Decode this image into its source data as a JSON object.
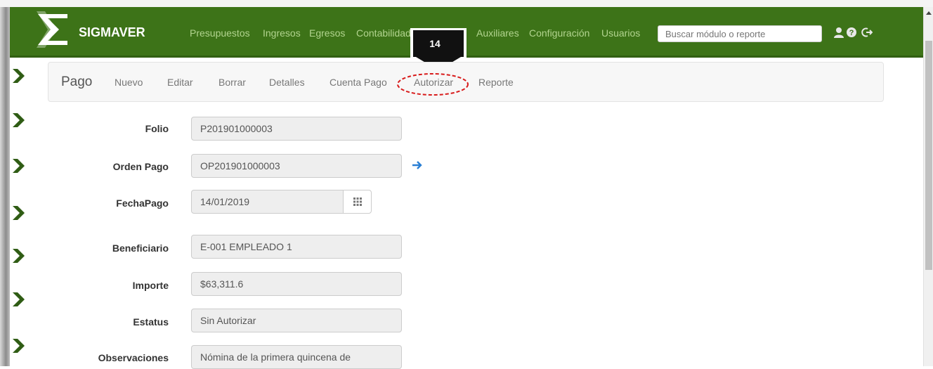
{
  "app": {
    "brand": "SIGMAVER",
    "accent_color": "#3d7318",
    "menu_color": "#b2d48f"
  },
  "navbar": {
    "menu": [
      "Presupuestos",
      "Ingresos",
      "Egresos",
      "Contabilidad",
      "Auxiliares",
      "Configuración",
      "Usuarios"
    ],
    "search_placeholder": "Buscar módulo o reporte",
    "icons": [
      "user-icon",
      "help-icon",
      "logout-icon"
    ]
  },
  "subnav": {
    "title": "Pago",
    "links": [
      "Nuevo",
      "Editar",
      "Borrar",
      "Detalles",
      "Cuenta Pago",
      "Autorizar",
      "Reporte"
    ]
  },
  "callout": {
    "number": "14"
  },
  "form": {
    "folio_label": "Folio",
    "folio_value": "P201901000003",
    "orden_label": "Orden Pago",
    "orden_value": "OP201901000003",
    "fecha_label": "FechaPago",
    "fecha_value": "14/01/2019",
    "beneficiario_label": "Beneficiario",
    "beneficiario_value": "E-001 EMPLEADO 1",
    "importe_label": "Importe",
    "importe_value": "$63,311.6",
    "estatus_label": "Estatus",
    "estatus_value": "Sin Autorizar",
    "observaciones_label": "Observaciones",
    "observaciones_value": "Nómina de la primera quincena de"
  }
}
